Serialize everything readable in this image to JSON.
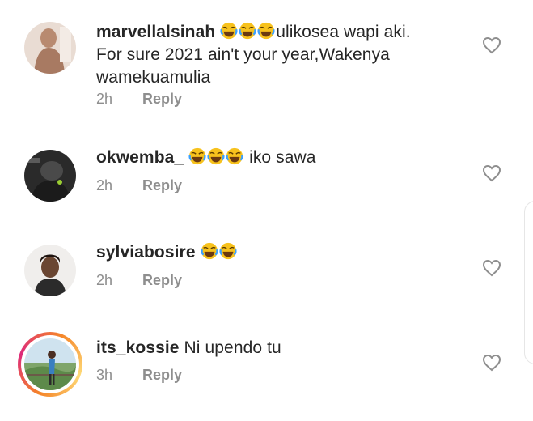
{
  "comments": [
    {
      "username": "marvellalsinah",
      "emoji_count": 3,
      "text": "ulikosea wapi aki.",
      "text_line2": "For sure 2021 ain't your year,Wakenya",
      "text_line3": "wamekuamulia",
      "time": "2h",
      "reply": "Reply",
      "avatar_icon": "person-avatar"
    },
    {
      "username": "okwemba_",
      "emoji_count": 3,
      "text": "iko sawa",
      "time": "2h",
      "reply": "Reply",
      "avatar_icon": "person-avatar"
    },
    {
      "username": "sylviabosire",
      "emoji_count": 2,
      "text": "",
      "time": "2h",
      "reply": "Reply",
      "avatar_icon": "person-avatar"
    },
    {
      "username": "its_kossie",
      "emoji_count": 0,
      "text": "Ni upendo tu",
      "time": "3h",
      "reply": "Reply",
      "avatar_icon": "person-avatar",
      "has_story_ring": true
    }
  ],
  "emoji": "face-with-tears-of-joy",
  "colors": {
    "text": "#262626",
    "meta": "#8e8e8e",
    "story_ring_start": "#f58529",
    "story_ring_end": "#dd2a7b"
  }
}
